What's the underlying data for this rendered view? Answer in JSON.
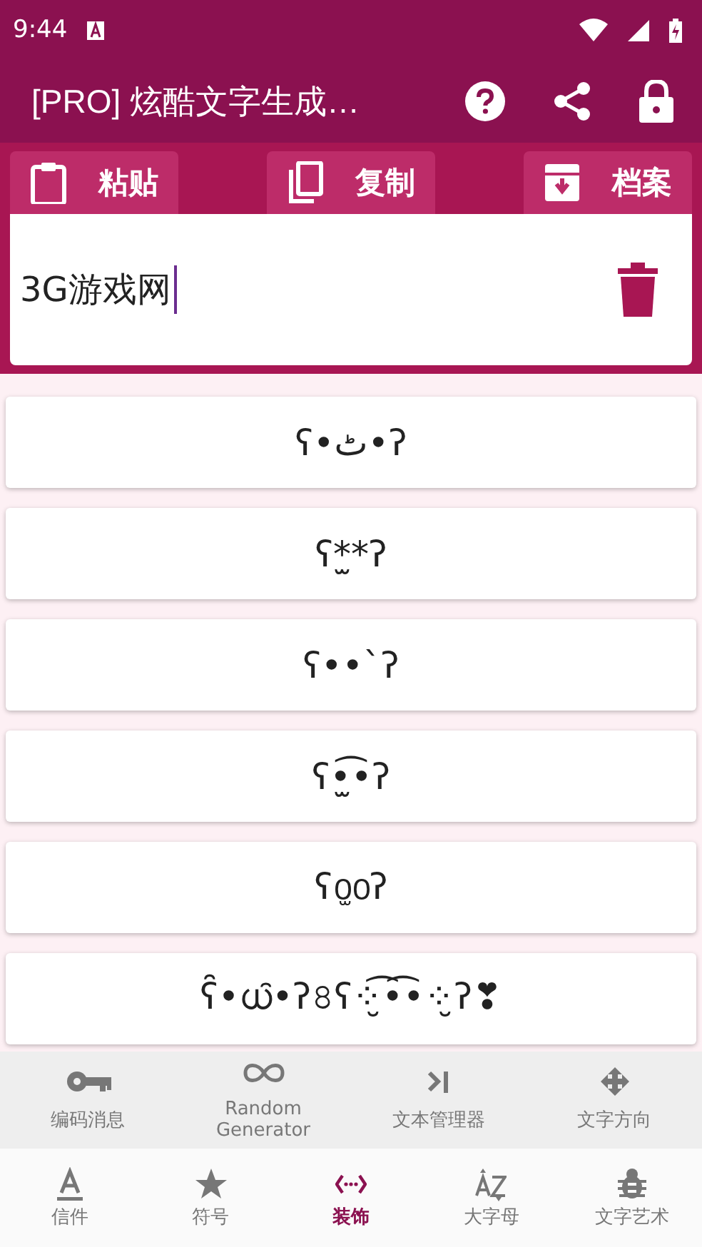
{
  "status_bar": {
    "time": "9:44"
  },
  "app_bar": {
    "title": "[PRO] 炫酷文字生成…"
  },
  "toolbar": [
    {
      "kind": "paste",
      "label": "粘贴"
    },
    {
      "kind": "copy",
      "label": "复制"
    },
    {
      "kind": "archive",
      "label": "档案"
    }
  ],
  "input": {
    "value": "3G游戏网",
    "focused": true
  },
  "results": [
    "ʕ•ٹ•ʔ",
    "ʕ*̫*ʔ",
    "ʕ••`ʔ",
    "ʕ•̫͡•ʔ",
    "ʕ൦̫൦ʔ",
    "ʕ̑•ധ̑•ʔ৪ʕ⁘̮͡•͡•⁘̮ʔ❣"
  ],
  "tools": [
    {
      "kind": "key",
      "label": "编码消息"
    },
    {
      "kind": "infinity",
      "label": "Random Generator"
    },
    {
      "kind": "cursor",
      "label": "文本管理器"
    },
    {
      "kind": "move",
      "label": "文字方向"
    }
  ],
  "bottom_nav": [
    {
      "kind": "letter",
      "label": "信件",
      "selected": false
    },
    {
      "kind": "star",
      "label": "符号",
      "selected": false
    },
    {
      "kind": "code",
      "label": "装饰",
      "selected": true
    },
    {
      "kind": "az",
      "label": "大字母",
      "selected": false
    },
    {
      "kind": "bug",
      "label": "文字艺术",
      "selected": false
    }
  ]
}
